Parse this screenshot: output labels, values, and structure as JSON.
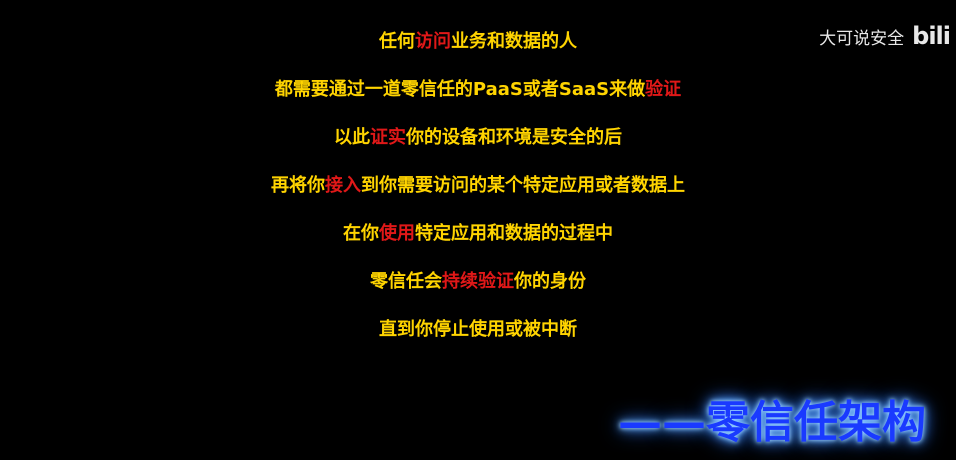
{
  "watermark": {
    "channel": "大可说安全",
    "logo": "bili"
  },
  "lines": [
    [
      {
        "text": "任何",
        "hl": false
      },
      {
        "text": "访问",
        "hl": true
      },
      {
        "text": "业务和数据的人",
        "hl": false
      }
    ],
    [
      {
        "text": "都需要通过一道零信任的PaaS或者SaaS来做",
        "hl": false
      },
      {
        "text": "验证",
        "hl": true
      }
    ],
    [
      {
        "text": "以此",
        "hl": false
      },
      {
        "text": "证实",
        "hl": true
      },
      {
        "text": "你的设备和环境是安全的后",
        "hl": false
      }
    ],
    [
      {
        "text": "再将你",
        "hl": false
      },
      {
        "text": "接入",
        "hl": true
      },
      {
        "text": "到你需要访问的某个特定应用或者数据上",
        "hl": false
      }
    ],
    [
      {
        "text": "在你",
        "hl": false
      },
      {
        "text": "使用",
        "hl": true
      },
      {
        "text": "特定应用和数据的过程中",
        "hl": false
      }
    ],
    [
      {
        "text": "零信任会",
        "hl": false
      },
      {
        "text": "持续验证",
        "hl": true
      },
      {
        "text": "你的身份",
        "hl": false
      }
    ],
    [
      {
        "text": "直到你停止使用或被中断",
        "hl": false
      }
    ]
  ],
  "signature": "——零信任架构",
  "colors": {
    "background": "#000000",
    "text": "#ffd400",
    "highlight": "#e01818",
    "signature": "#1a3aff"
  }
}
